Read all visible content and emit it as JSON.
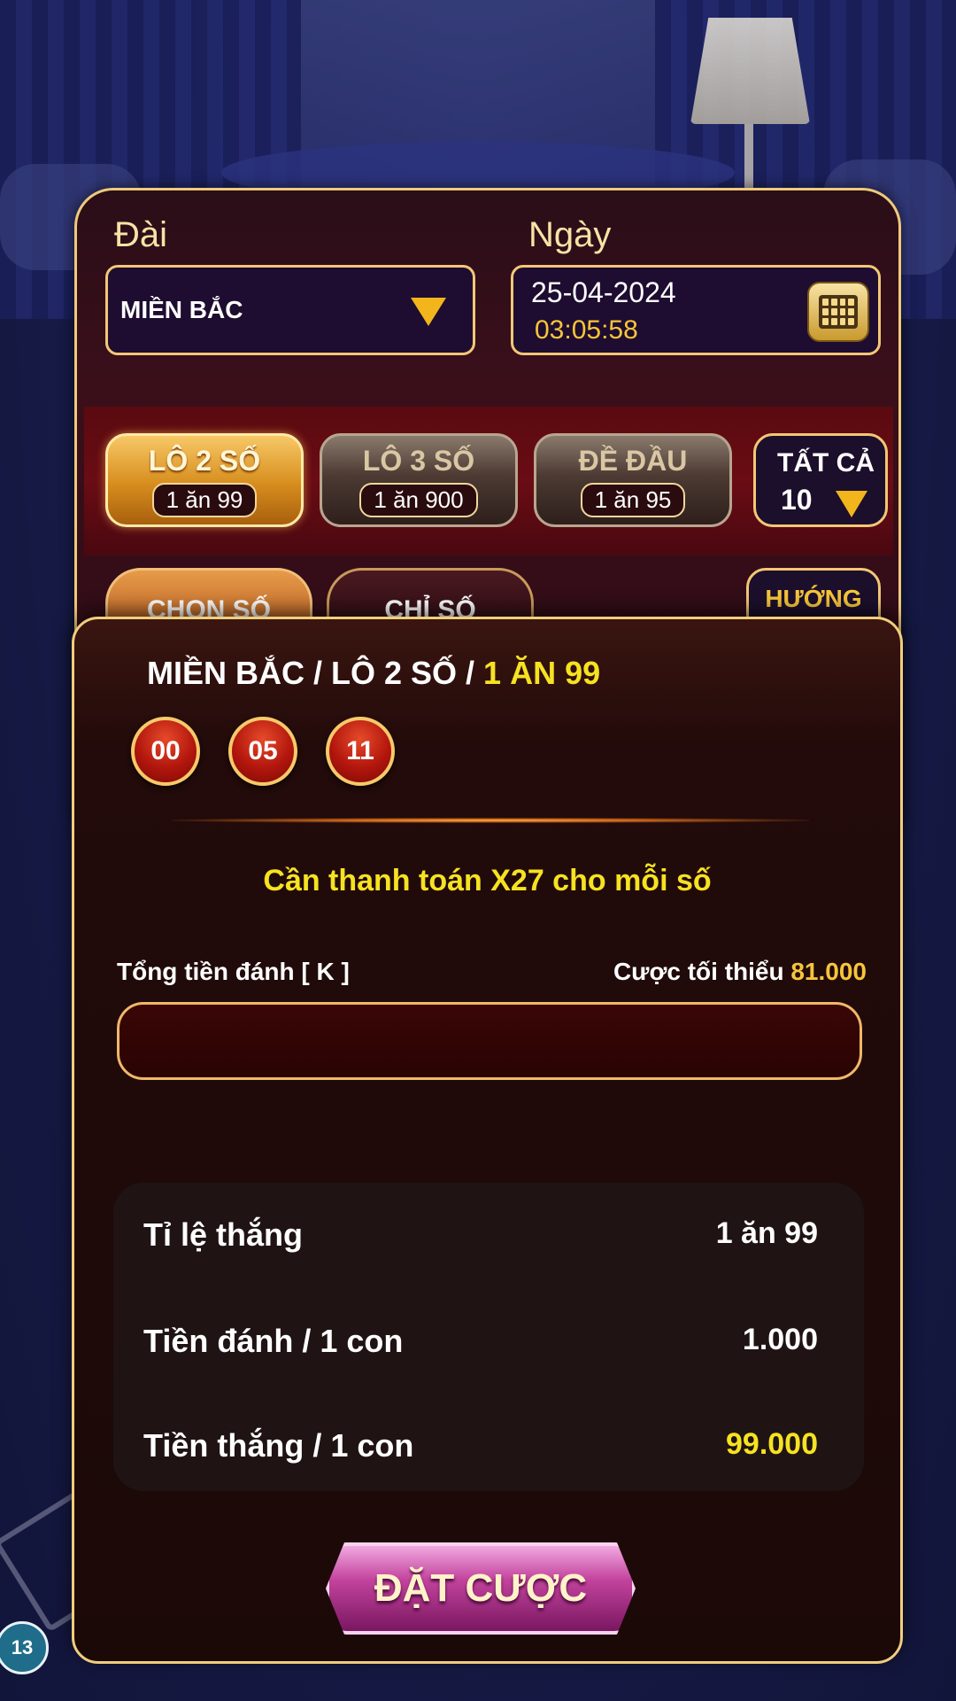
{
  "header": {
    "station_label": "Đài",
    "date_label": "Ngày",
    "station_value": "MIỀN BẮC",
    "date_value": "25-04-2024",
    "time_value": "03:05:58"
  },
  "bet_types": [
    {
      "name": "LÔ 2 SỐ",
      "rate": "1 ăn 99",
      "active": true
    },
    {
      "name": "LÔ 3 SỐ",
      "rate": "1 ăn 900",
      "active": false
    },
    {
      "name": "ĐỀ ĐẦU",
      "rate": "1 ăn 95",
      "active": false
    }
  ],
  "all_filter": {
    "label": "TẤT CẢ",
    "count": "10"
  },
  "tabs": {
    "choose": "CHỌN SỐ",
    "only": "CHỈ SỐ",
    "guide": "HƯỚNG"
  },
  "modal": {
    "breadcrumb_main": "MIỀN BẮC / LÔ 2 SỐ / ",
    "breadcrumb_highlight": "1 ĂN 99",
    "selected_numbers": [
      "00",
      "05",
      "11"
    ],
    "pay_note": "Cần thanh toán X27 cho mỗi số",
    "total_label": "Tổng tiền đánh [ K ]",
    "min_label": "Cược tối thiểu ",
    "min_value": "81.000",
    "amount_value": "",
    "summary": {
      "win_rate_label": "Tỉ lệ thắng",
      "win_rate_value": "1 ăn 99",
      "stake_label": "Tiền đánh / 1 con",
      "stake_value": "1.000",
      "win_label": "Tiền thắng / 1 con",
      "win_value": "99.000"
    },
    "bet_button": "ĐẶT CƯỢC"
  },
  "background": {
    "ball_number": "13"
  },
  "colors": {
    "gold": "#f6e221",
    "accent_orange": "#f6c53a",
    "panel_border": "#f1cd7d",
    "button_pink": "#c2439d"
  }
}
